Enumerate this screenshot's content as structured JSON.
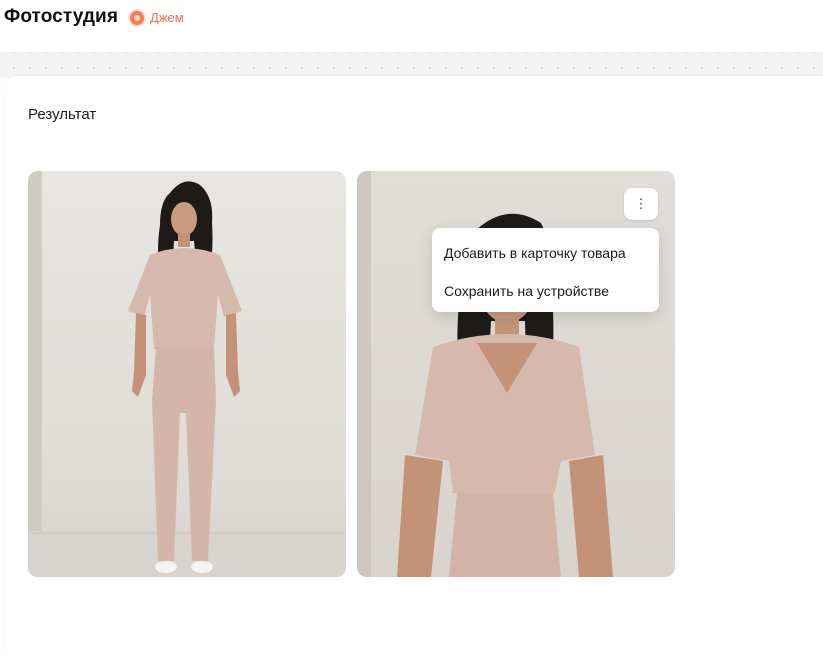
{
  "header": {
    "title": "Фотостудия",
    "badge_label": "Джем",
    "badge_icon": "jam-icon",
    "accent_color": "#ef6f48"
  },
  "result": {
    "title": "Результат",
    "images": [
      {
        "name": "result-photo-full-body"
      },
      {
        "name": "result-photo-half-body"
      }
    ]
  },
  "context_menu": {
    "trigger_icon": "more-vertical-icon",
    "trigger_glyph": "⋮",
    "items": [
      {
        "label": "Добавить в карточку товара"
      },
      {
        "label": "Сохранить на устройстве"
      }
    ]
  }
}
